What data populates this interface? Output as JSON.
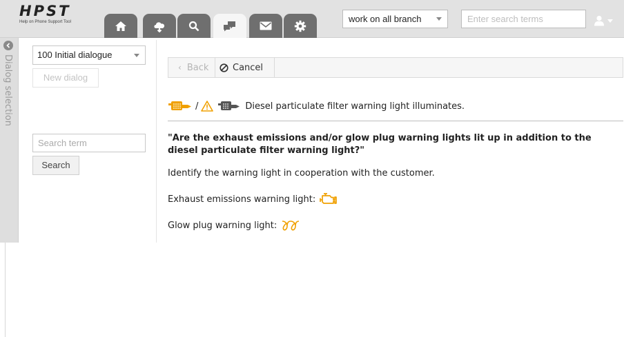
{
  "app": {
    "logo_title": "HPST",
    "logo_subtitle": "Help on Phone Support Tool"
  },
  "header": {
    "tabs": [
      {
        "icon": "home-icon",
        "active": false
      },
      {
        "icon": "cloud-icon",
        "active": false
      },
      {
        "icon": "search-icon",
        "active": false
      },
      {
        "icon": "chat-icon",
        "active": true
      },
      {
        "icon": "mail-icon",
        "active": false
      },
      {
        "icon": "gear-icon",
        "active": false
      }
    ],
    "branch_select_value": "work on all branch",
    "search_placeholder": "Enter search terms",
    "user_icon": "user-icon"
  },
  "sidebar": {
    "label": "Dialog selection",
    "dialog_select_value": "100 Initial dialogue",
    "new_dialog_label": "New dialog",
    "search_term_placeholder": "Search term",
    "search_button_label": "Search"
  },
  "toolbar": {
    "back_label": "Back",
    "cancel_label": "Cancel"
  },
  "content": {
    "slash": "/",
    "symptom_text": "Diesel particulate filter warning light illuminates.",
    "question": "\"Are the exhaust emissions and/or glow plug warning lights lit up in addition to the diesel particulate filter warning light?\"",
    "instruction": "Identify the warning light in cooperation with the customer.",
    "exhaust_label": "Exhaust emissions warning light:",
    "glow_label": "Glow plug warning light:"
  },
  "colors": {
    "header_bg": "#e2e2e2",
    "tab_bg": "#6f6f6f",
    "tab_active_bg": "#f6f6f6",
    "warning_amber": "#f0a000"
  }
}
